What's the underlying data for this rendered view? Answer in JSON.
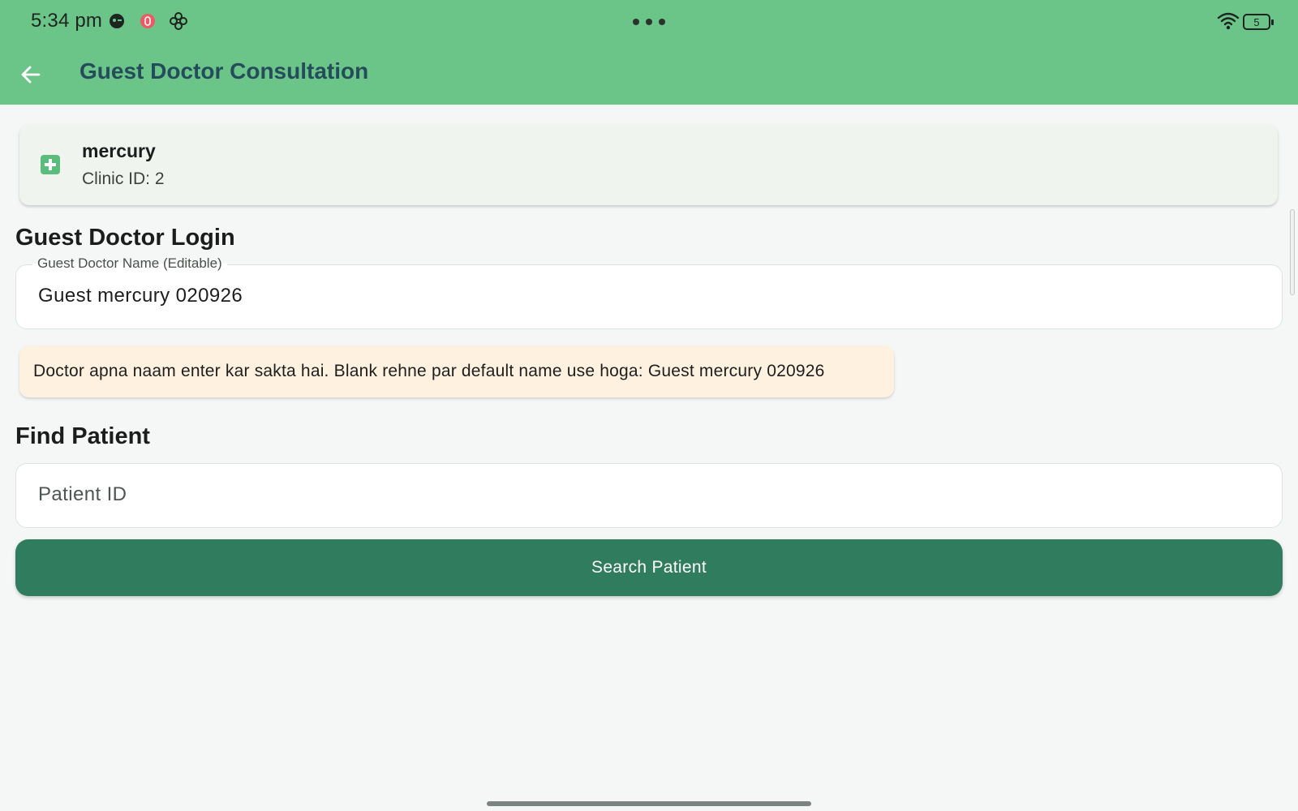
{
  "status_bar": {
    "time": "5:34 pm",
    "battery_level": "5",
    "icons": [
      "game-controller-icon",
      "notification-badge-icon",
      "pinwheel-icon",
      "more-dots-icon",
      "wifi-icon",
      "battery-icon"
    ]
  },
  "app_bar": {
    "title": "Guest Doctor Consultation",
    "back_icon": "arrow-left-icon"
  },
  "clinic": {
    "name": "mercury",
    "id_text": "Clinic ID: 2",
    "icon": "medical-plus-icon"
  },
  "guest_login": {
    "section_title": "Guest Doctor Login",
    "name_field_label": "Guest Doctor Name (Editable)",
    "name_field_value": "Guest mercury 020926",
    "info_text": "Doctor apna naam enter kar sakta hai. Blank rehne par default name use hoga: Guest mercury 020926"
  },
  "find_patient": {
    "section_title": "Find Patient",
    "patient_id_placeholder": "Patient ID",
    "search_button_label": "Search Patient"
  },
  "colors": {
    "app_bar": "#6cc588",
    "title_text": "#244c5a",
    "primary_button": "#2f7c5e",
    "info_background": "#fff1df",
    "card_background": "#eff4ef"
  }
}
